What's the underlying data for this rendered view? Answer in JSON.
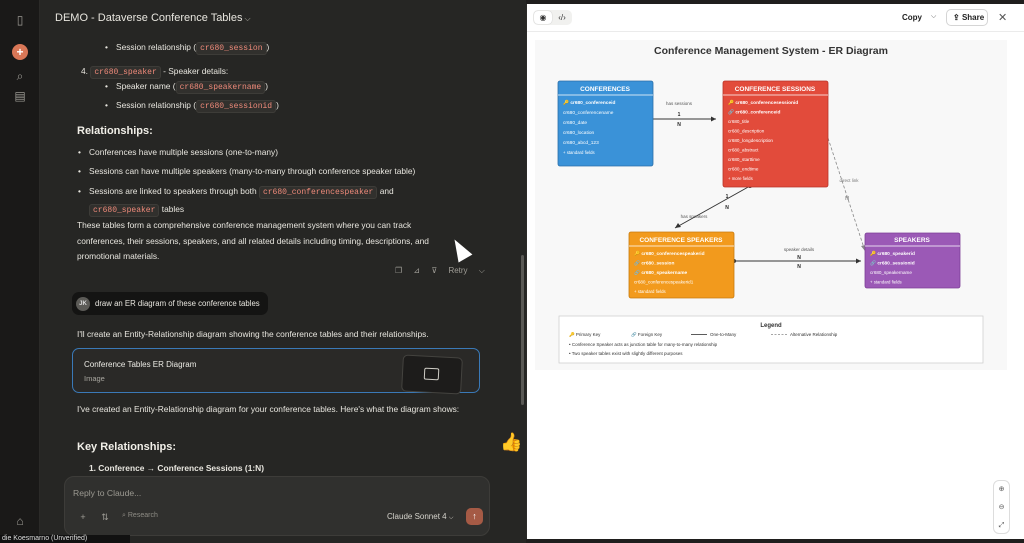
{
  "rail": {
    "icons": [
      "sidebar-toggle-icon",
      "new-chat-icon",
      "search-icon",
      "chats-icon",
      "user-initials-icon"
    ]
  },
  "chat": {
    "title": "DEMO - Dataverse Conference Tables",
    "truncated_top": {
      "line1_label": "Session relationship (",
      "line1_code": "cr680_session",
      "line1_suffix": ")"
    },
    "item4": {
      "number": "4.",
      "code": "cr680_speaker",
      "suffix": "- Speaker details:",
      "sub": [
        {
          "label": "Speaker name (",
          "code": "cr680_speakername",
          "suffix": ")"
        },
        {
          "label": "Session relationship (",
          "code": "cr680_sessionid",
          "suffix": ")"
        }
      ]
    },
    "relationships_heading": "Relationships:",
    "relationships": [
      {
        "text": "Conferences have multiple sessions (one-to-many)"
      },
      {
        "text": "Sessions can have multiple speakers (many-to-many through conference speaker table)"
      },
      {
        "pre": "Sessions are linked to speakers through both",
        "code1": "cr680_conferencespeaker",
        "mid": "and",
        "code2": "cr680_speaker",
        "post": "tables"
      }
    ],
    "summary": "These tables form a comprehensive conference management system where you can track conferences, their sessions, speakers, and all related details including timing, descriptions, and promotional materials.",
    "retry_label": "Retry",
    "user_initials": "JK",
    "user_message": "draw an ER diagram of these conference tables",
    "assistant_intro": "I'll create an Entity-Relationship diagram showing the conference tables and their relationships.",
    "artifact": {
      "title": "Conference Tables ER Diagram",
      "kind": "Image"
    },
    "assistant_followup": "I've created an Entity-Relationship diagram for your conference tables. Here's what the diagram shows:",
    "key_heading": "Key Relationships:",
    "key_item1": "1. Conference → Conference Sessions (1:N)",
    "composer": {
      "placeholder": "Reply to Claude...",
      "research": "Research",
      "model": "Claude Sonnet 4"
    },
    "footer_tag": "die Koesmarno (Unverified)"
  },
  "panel": {
    "copy_label": "Copy",
    "share_label": "Share"
  },
  "diagram": {
    "title": "Conference Management System - ER Diagram",
    "entities": [
      {
        "name": "CONFERENCES",
        "color": "#3a92d8",
        "fields": [
          {
            "icon": "key",
            "text": "cr680_conferenceid",
            "bold": true
          },
          {
            "icon": "",
            "text": "cr680_conferencename"
          },
          {
            "icon": "",
            "text": "cr680_date"
          },
          {
            "icon": "",
            "text": "cr680_location"
          },
          {
            "icon": "",
            "text": "cr680_abcd_123"
          },
          {
            "icon": "",
            "text": "+ standard fields"
          }
        ]
      },
      {
        "name": "CONFERENCE SESSIONS",
        "color": "#e24b3b",
        "fields": [
          {
            "icon": "key",
            "text": "cr680_conferencesessionid",
            "bold": true
          },
          {
            "icon": "link",
            "text": "cr680_conferenceid",
            "bold": true
          },
          {
            "icon": "",
            "text": "cr680_title"
          },
          {
            "icon": "",
            "text": "cr680_description"
          },
          {
            "icon": "",
            "text": "cr680_longdescription"
          },
          {
            "icon": "",
            "text": "cr680_abstract"
          },
          {
            "icon": "",
            "text": "cr680_starttime"
          },
          {
            "icon": "",
            "text": "cr680_endtime"
          },
          {
            "icon": "",
            "text": "+ more fields"
          }
        ]
      },
      {
        "name": "CONFERENCE SPEAKERS",
        "color": "#f29a1d",
        "fields": [
          {
            "icon": "key",
            "text": "cr680_conferencespeakerid",
            "bold": true
          },
          {
            "icon": "link",
            "text": "cr680_session",
            "bold": true
          },
          {
            "icon": "link",
            "text": "cr680_speakername",
            "bold": true
          },
          {
            "icon": "",
            "text": "cr680_conferencespeakerid1"
          },
          {
            "icon": "",
            "text": "+ standard fields"
          }
        ]
      },
      {
        "name": "SPEAKERS",
        "color": "#9b59b6",
        "fields": [
          {
            "icon": "key",
            "text": "cr680_speakerid",
            "bold": true
          },
          {
            "icon": "link",
            "text": "cr680_sessionid",
            "bold": true
          },
          {
            "icon": "",
            "text": "cr680_speakername"
          },
          {
            "icon": "",
            "text": "+ standard fields"
          }
        ]
      }
    ],
    "relations": [
      {
        "label": "has sessions",
        "a": "1",
        "b": "N"
      },
      {
        "label": "has speakers",
        "a": "1",
        "b": "N"
      },
      {
        "label": "speaker details",
        "a": "N",
        "b": "N"
      },
      {
        "label": "direct link",
        "a": "",
        "b": "N"
      }
    ],
    "legend": {
      "title": "Legend",
      "primary": "Primary Key",
      "foreign": "Foreign Key",
      "one_to_many": "One-to-Many",
      "alternative": "Alternative Relationship",
      "note1": "• Conference Speaker acts as junction table for many-to-many relationship",
      "note2": "• Two speaker tables exist with slightly different purposes"
    }
  }
}
